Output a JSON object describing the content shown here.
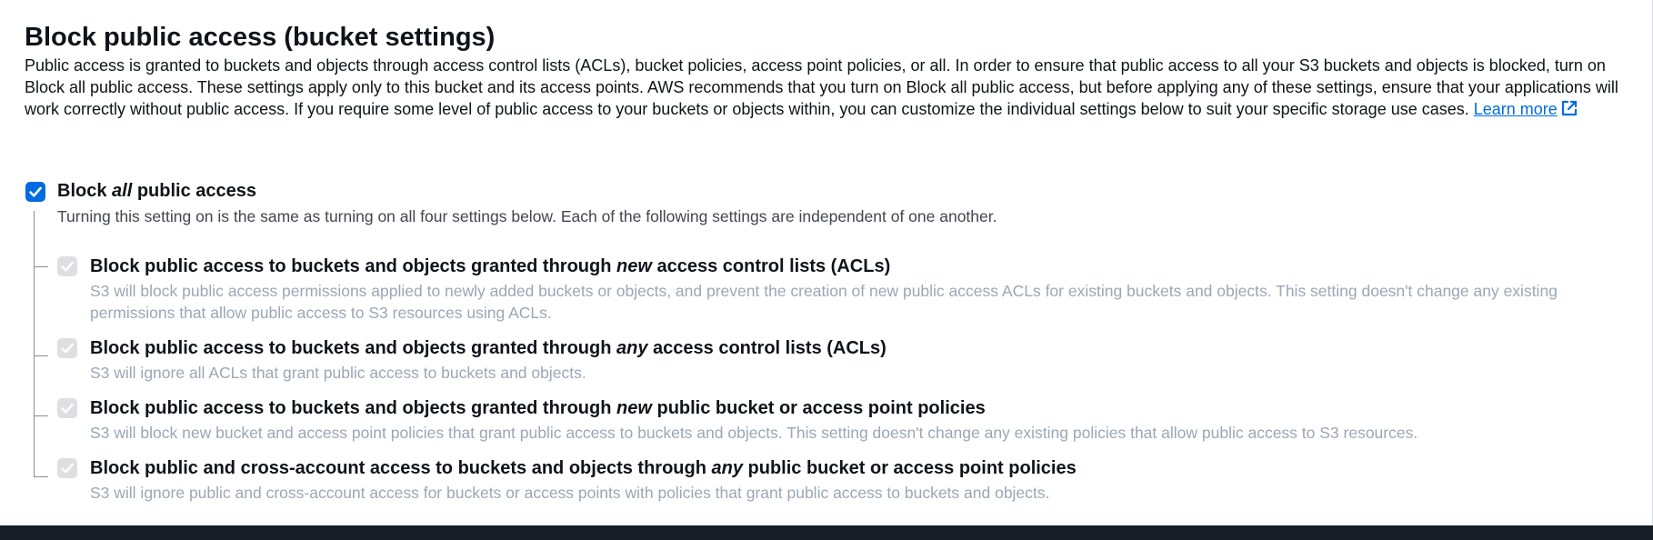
{
  "section": {
    "title": "Block public access (bucket settings)",
    "description": "Public access is granted to buckets and objects through access control lists (ACLs), bucket policies, access point policies, or all. In order to ensure that public access to all your S3 buckets and objects is blocked, turn on Block all public access. These settings apply only to this bucket and its access points. AWS recommends that you turn on Block all public access, but before applying any of these settings, ensure that your applications will work correctly without public access. If you require some level of public access to your buckets or objects within, you can customize the individual settings below to suit your specific storage use cases.",
    "learn_more": "Learn more"
  },
  "master": {
    "checked": true,
    "label_pre": "Block ",
    "label_em": "all",
    "label_post": " public access",
    "description": "Turning this setting on is the same as turning on all four settings below. Each of the following settings are independent of one another."
  },
  "options": [
    {
      "checked": true,
      "disabled": true,
      "label_pre": "Block public access to buckets and objects granted through ",
      "label_em": "new",
      "label_post": " access control lists (ACLs)",
      "description": "S3 will block public access permissions applied to newly added buckets or objects, and prevent the creation of new public access ACLs for existing buckets and objects. This setting doesn't change any existing permissions that allow public access to S3 resources using ACLs."
    },
    {
      "checked": true,
      "disabled": true,
      "label_pre": "Block public access to buckets and objects granted through ",
      "label_em": "any",
      "label_post": " access control lists (ACLs)",
      "description": "S3 will ignore all ACLs that grant public access to buckets and objects."
    },
    {
      "checked": true,
      "disabled": true,
      "label_pre": "Block public access to buckets and objects granted through ",
      "label_em": "new",
      "label_post": " public bucket or access point policies",
      "description": "S3 will block new bucket and access point policies that grant public access to buckets and objects. This setting doesn't change any existing policies that allow public access to S3 resources."
    },
    {
      "checked": true,
      "disabled": true,
      "label_pre": "Block public and cross-account access to buckets and objects through ",
      "label_em": "any",
      "label_post": " public bucket or access point policies",
      "description": "S3 will ignore public and cross-account access for buckets or access points with policies that grant public access to buckets and objects."
    }
  ],
  "colors": {
    "primary": "#006ce0",
    "disabled_checkbox": "#dedee3",
    "disabled_text": "#9ba7b6",
    "footer_bar": "#161d26"
  },
  "icons": {
    "learn_more": "external-link-icon",
    "checkbox": "checkmark-icon"
  }
}
